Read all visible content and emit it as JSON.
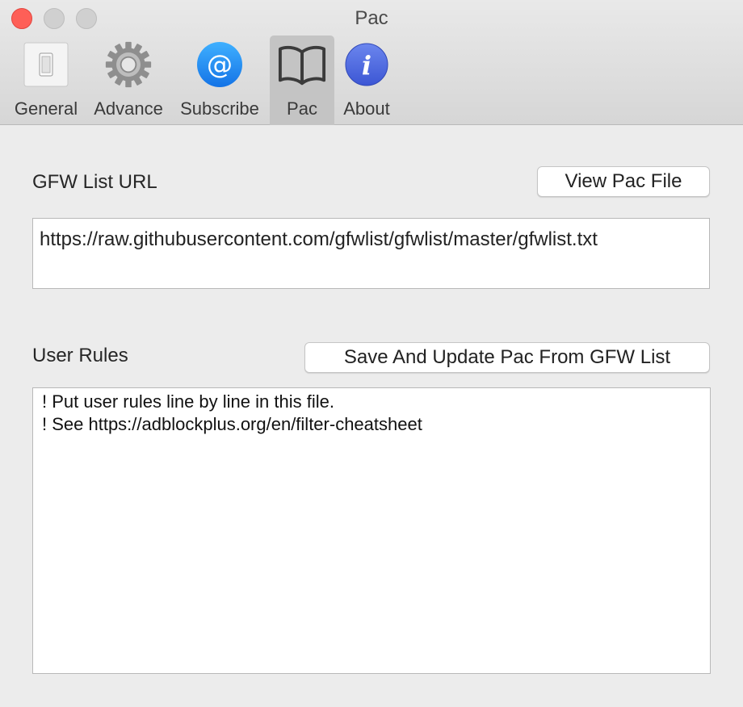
{
  "window": {
    "title": "Pac"
  },
  "toolbar": {
    "items": [
      {
        "label": "General",
        "icon": "light-switch-icon",
        "selected": false
      },
      {
        "label": "Advance",
        "icon": "gear-icon",
        "selected": false
      },
      {
        "label": "Subscribe",
        "icon": "at-sign-icon",
        "selected": false
      },
      {
        "label": "Pac",
        "icon": "book-icon",
        "selected": true
      },
      {
        "label": "About",
        "icon": "info-icon",
        "selected": false
      }
    ]
  },
  "gfw": {
    "label": "GFW List URL",
    "view_button": "View Pac File",
    "url": "https://raw.githubusercontent.com/gfwlist/gfwlist/master/gfwlist.txt"
  },
  "rules": {
    "label": "User Rules",
    "update_button": "Save And Update Pac From GFW List",
    "lines": [
      "! Put user rules line by line in this file.",
      "! See https://adblockplus.org/en/filter-cheatsheet"
    ]
  },
  "colors": {
    "close": "#fe5f57",
    "accent_blue": "#1e88f5",
    "info_blue": "#4f6ae0"
  }
}
